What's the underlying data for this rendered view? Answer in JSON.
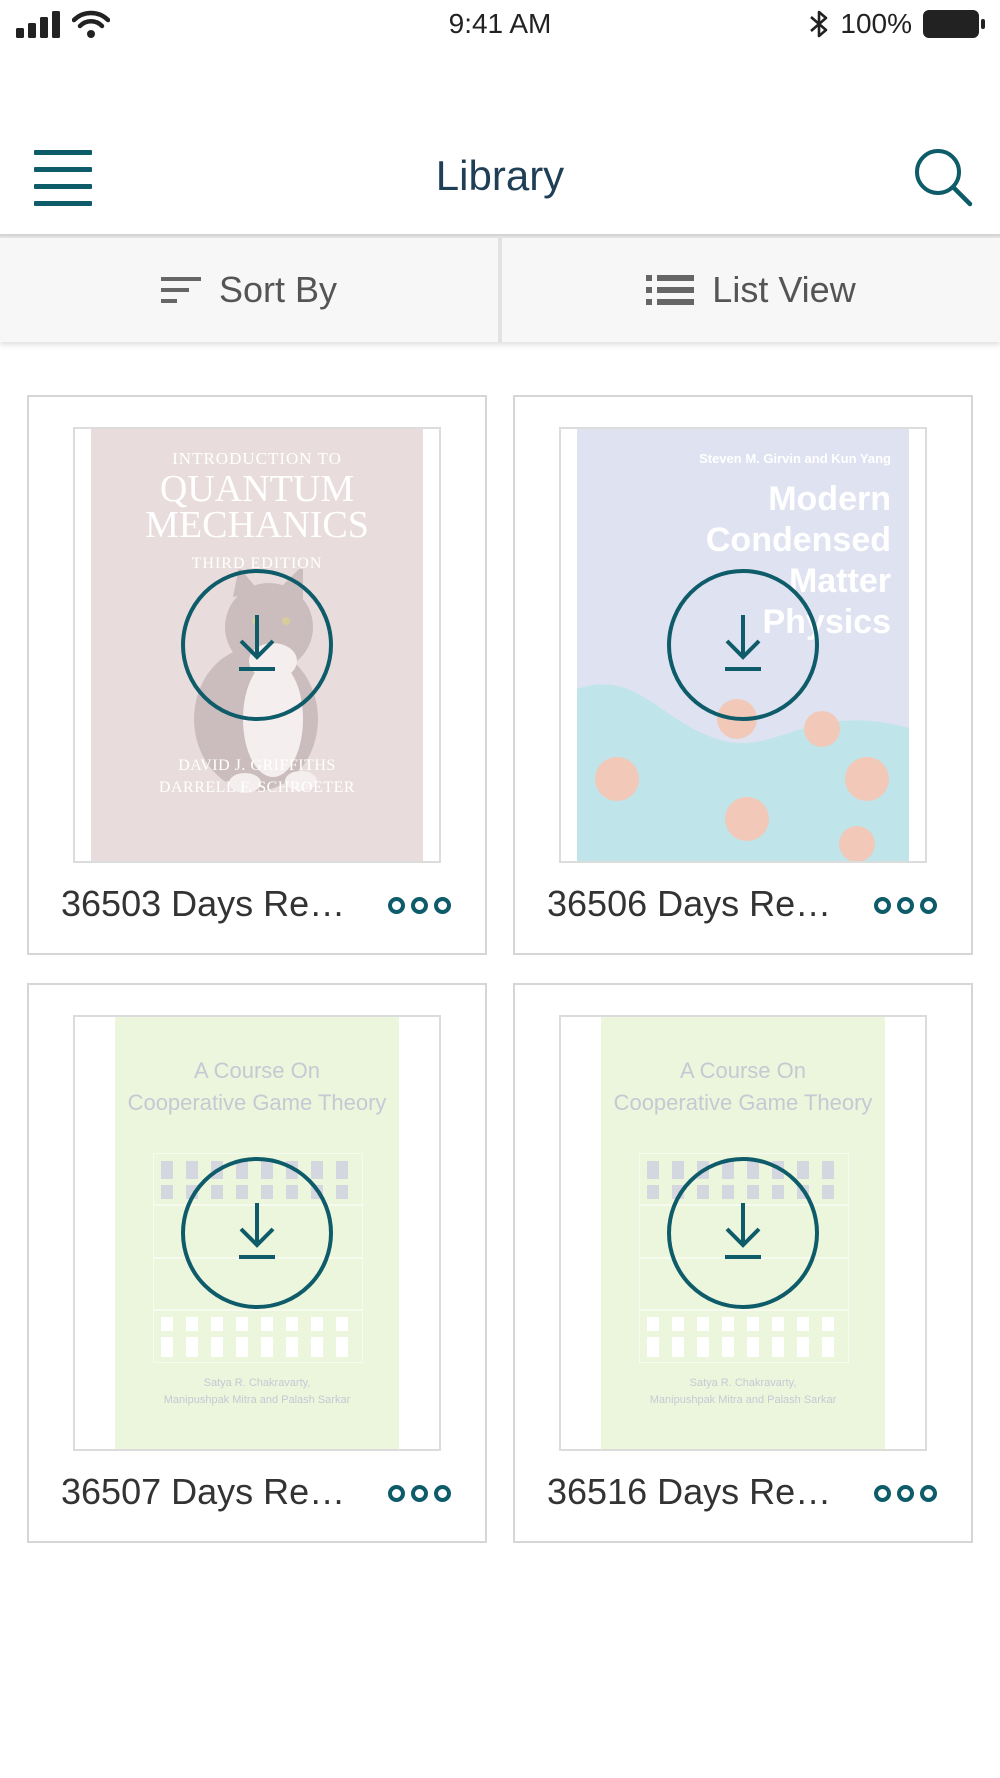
{
  "status_bar": {
    "time": "9:41 AM",
    "battery": "100%",
    "icons": [
      "signal-icon",
      "wifi-icon",
      "bluetooth-icon",
      "battery-icon"
    ]
  },
  "header": {
    "title": "Library",
    "menu_icon": "hamburger-menu-icon",
    "search_icon": "search-icon"
  },
  "toolbar": {
    "sort_label": "Sort By",
    "view_label": "List View"
  },
  "books": [
    {
      "title": "36503 Days Re…",
      "cover": {
        "top": "INTRODUCTION TO",
        "title_lines": [
          "QUANTUM",
          "MECHANICS"
        ],
        "edition": "THIRD EDITION",
        "authors": [
          "DAVID J. GRIFFITHS",
          "DARRELL F. SCHROETER"
        ]
      }
    },
    {
      "title": "36506 Days Re…",
      "cover": {
        "top": "Steven M. Girvin and Kun Yang",
        "title_lines": [
          "Modern",
          "Condensed",
          "Matter",
          "Physics"
        ]
      }
    },
    {
      "title": "36507 Days Re…",
      "cover": {
        "title_lines": [
          "A Course On",
          "Cooperative Game Theory"
        ],
        "authors": [
          "Satya R. Chakravarty,",
          "Manipushpak Mitra and Palash Sarkar"
        ]
      }
    },
    {
      "title": "36516 Days Re…",
      "cover": {
        "title_lines": [
          "A Course On",
          "Cooperative Game Theory"
        ],
        "authors": [
          "Satya R. Chakravarty,",
          "Manipushpak Mitra and Palash Sarkar"
        ]
      }
    }
  ],
  "colors": {
    "accent": "#0e5b69",
    "title": "#1f3f57"
  }
}
